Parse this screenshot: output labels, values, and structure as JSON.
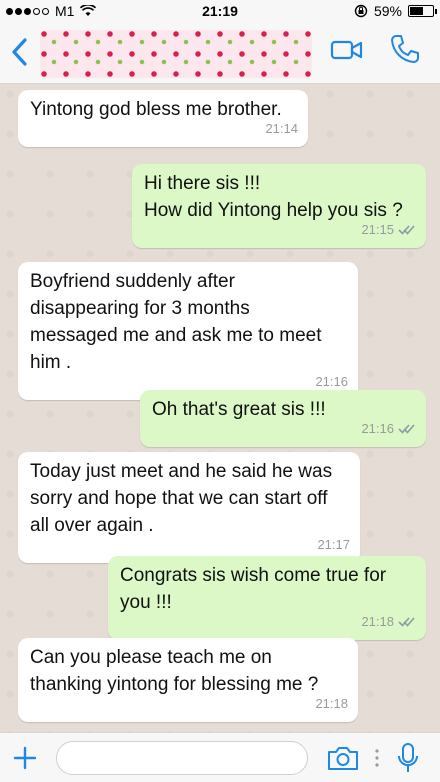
{
  "status_bar": {
    "carrier": "M1",
    "time": "21:19",
    "battery_percent": "59%",
    "signal_bars_filled": 3,
    "signal_bars_total": 5,
    "battery_level": 0.59
  },
  "header": {
    "back_icon": "chevron-left-icon",
    "avatar_style": "cherry-pattern",
    "video_icon": "video-camera-icon",
    "call_icon": "phone-icon",
    "accent_color": "#1e88e5"
  },
  "messages": [
    {
      "direction": "in",
      "lines": [
        "Yintong god bless me brother."
      ],
      "time": "21:14"
    },
    {
      "direction": "out",
      "lines": [
        "Hi there sis !!!",
        "How did Yintong help you sis ?"
      ],
      "time": "21:15",
      "read": true
    },
    {
      "direction": "in",
      "lines": [
        "Boyfriend suddenly after",
        "disappearing for 3 months",
        "messaged me and ask me to meet",
        "him ."
      ],
      "time": "21:16"
    },
    {
      "direction": "out",
      "lines": [
        "Oh that's great sis !!!"
      ],
      "time": "21:16",
      "read": true
    },
    {
      "direction": "in",
      "lines": [
        "Today just meet and he said he was",
        "sorry and hope that we can start off",
        "all over again ."
      ],
      "time": "21:17"
    },
    {
      "direction": "out",
      "lines": [
        "Congrats sis wish come true for",
        "you !!!"
      ],
      "time": "21:18",
      "read": true
    },
    {
      "direction": "in",
      "lines": [
        "Can you please teach me on",
        "thanking yintong for blessing me ?"
      ],
      "time": "21:18"
    }
  ],
  "colors": {
    "incoming_bubble": "#ffffff",
    "outgoing_bubble": "#dcf8c6",
    "chat_background": "#e5ddd5",
    "icon_blue": "#1e88e5"
  },
  "input": {
    "placeholder": "",
    "value": ""
  }
}
